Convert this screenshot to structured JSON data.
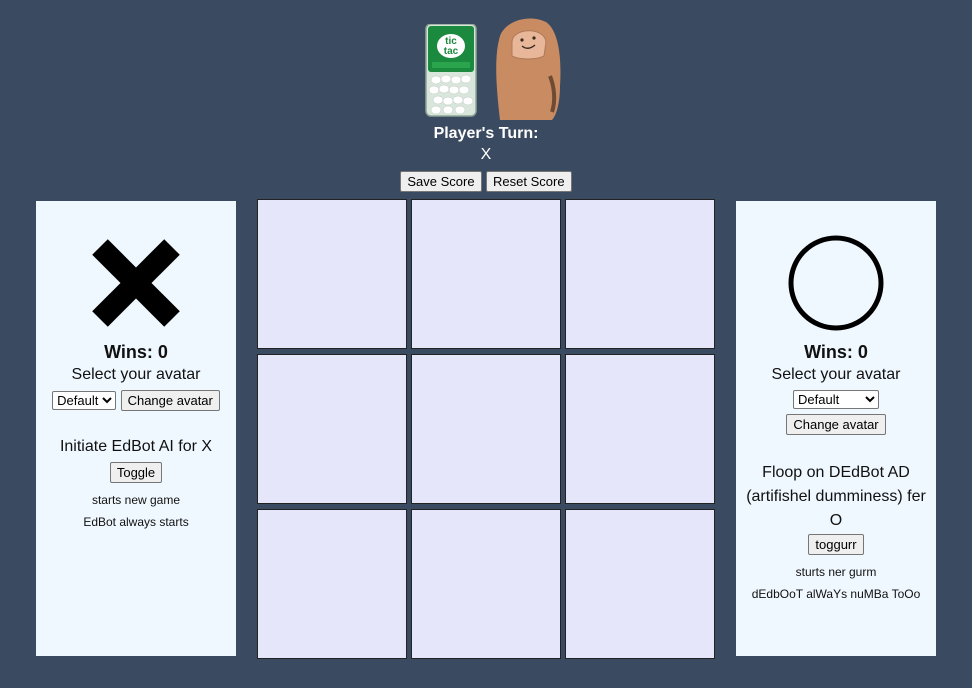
{
  "header": {
    "tictac_text": "tic tac",
    "turn_label": "Player's Turn:",
    "turn_value": "X",
    "save_score_label": "Save Score",
    "reset_score_label": "Reset Score"
  },
  "player_x": {
    "symbol": "X",
    "wins_text": "Wins: 0",
    "select_label": "Select your avatar",
    "avatar_selected": "Default",
    "change_avatar_label": "Change avatar",
    "ai_label": "Initiate EdBot AI for X",
    "toggle_label": "Toggle",
    "note1": "starts new game",
    "note2": "EdBot always starts"
  },
  "player_o": {
    "symbol": "O",
    "wins_text": "Wins: 0",
    "select_label": "Select your avatar",
    "avatar_selected": "Default",
    "change_avatar_label": "Change avatar",
    "ai_label": "Floop on DEdBot AD (artifishel dumminess) fer O",
    "toggle_label": "toggurr",
    "note1": "sturts ner gurm",
    "note2": "dEdbOoT alWaYs nuMBa ToOo"
  },
  "board": {
    "cells": [
      "",
      "",
      "",
      "",
      "",
      "",
      "",
      "",
      ""
    ]
  },
  "colors": {
    "background": "#3a4a60",
    "panel": "#f0f8ff",
    "cell": "#e6e6fa"
  }
}
